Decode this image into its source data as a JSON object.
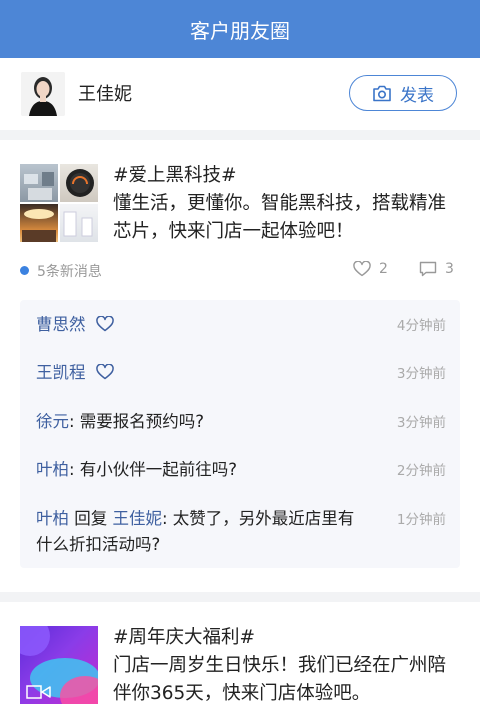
{
  "header": {
    "title": "客户朋友圈"
  },
  "profile": {
    "name": "王佳妮",
    "post_button": "发表"
  },
  "post1": {
    "tag": "#爱上黑科技#",
    "body": "懂生活，更懂你。智能黑科技，搭载精准芯片，快来门店一起体验吧！",
    "new_messages": "5条新消息",
    "likes": "2",
    "comments_count": "3",
    "comments": [
      {
        "user": "曹思然",
        "type": "like",
        "time": "4分钟前"
      },
      {
        "user": "王凯程",
        "type": "like",
        "time": "3分钟前"
      },
      {
        "user": "徐元",
        "text": ": 需要报名预约吗?",
        "time": "3分钟前"
      },
      {
        "user": "叶柏",
        "text": ": 有小伙伴一起前往吗?",
        "time": "2分钟前"
      },
      {
        "user": "叶柏",
        "reply_word": " 回复 ",
        "reply_to": "王佳妮",
        "text": ": 太赞了，另外最近店里有什么折扣活动吗?",
        "time": "1分钟前"
      }
    ]
  },
  "post2": {
    "tag": "#周年庆大福利#",
    "body": "门店一周岁生日快乐！我们已经在广州陪伴你365天，快来门店体验吧。"
  },
  "colors": {
    "header": "#4d86d6",
    "accent": "#3b82e0",
    "username": "#3f60a0"
  },
  "icons": [
    "camera-icon",
    "heart-icon",
    "comment-icon",
    "video-icon"
  ]
}
